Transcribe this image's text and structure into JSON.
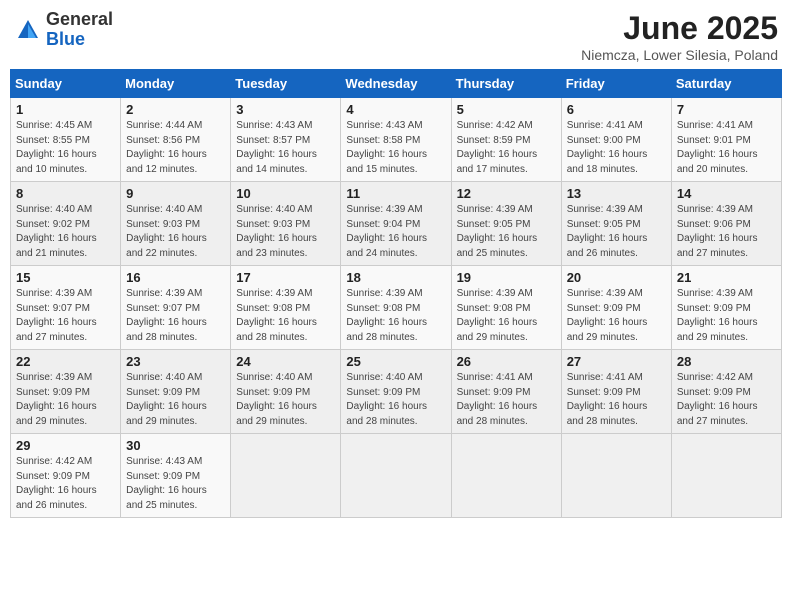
{
  "logo": {
    "general": "General",
    "blue": "Blue"
  },
  "title": "June 2025",
  "location": "Niemcza, Lower Silesia, Poland",
  "weekdays": [
    "Sunday",
    "Monday",
    "Tuesday",
    "Wednesday",
    "Thursday",
    "Friday",
    "Saturday"
  ],
  "days": [
    {
      "date": 1,
      "sunrise": "4:45 AM",
      "sunset": "8:55 PM",
      "daylight": "16 hours and 10 minutes."
    },
    {
      "date": 2,
      "sunrise": "4:44 AM",
      "sunset": "8:56 PM",
      "daylight": "16 hours and 12 minutes."
    },
    {
      "date": 3,
      "sunrise": "4:43 AM",
      "sunset": "8:57 PM",
      "daylight": "16 hours and 14 minutes."
    },
    {
      "date": 4,
      "sunrise": "4:43 AM",
      "sunset": "8:58 PM",
      "daylight": "16 hours and 15 minutes."
    },
    {
      "date": 5,
      "sunrise": "4:42 AM",
      "sunset": "8:59 PM",
      "daylight": "16 hours and 17 minutes."
    },
    {
      "date": 6,
      "sunrise": "4:41 AM",
      "sunset": "9:00 PM",
      "daylight": "16 hours and 18 minutes."
    },
    {
      "date": 7,
      "sunrise": "4:41 AM",
      "sunset": "9:01 PM",
      "daylight": "16 hours and 20 minutes."
    },
    {
      "date": 8,
      "sunrise": "4:40 AM",
      "sunset": "9:02 PM",
      "daylight": "16 hours and 21 minutes."
    },
    {
      "date": 9,
      "sunrise": "4:40 AM",
      "sunset": "9:03 PM",
      "daylight": "16 hours and 22 minutes."
    },
    {
      "date": 10,
      "sunrise": "4:40 AM",
      "sunset": "9:03 PM",
      "daylight": "16 hours and 23 minutes."
    },
    {
      "date": 11,
      "sunrise": "4:39 AM",
      "sunset": "9:04 PM",
      "daylight": "16 hours and 24 minutes."
    },
    {
      "date": 12,
      "sunrise": "4:39 AM",
      "sunset": "9:05 PM",
      "daylight": "16 hours and 25 minutes."
    },
    {
      "date": 13,
      "sunrise": "4:39 AM",
      "sunset": "9:05 PM",
      "daylight": "16 hours and 26 minutes."
    },
    {
      "date": 14,
      "sunrise": "4:39 AM",
      "sunset": "9:06 PM",
      "daylight": "16 hours and 27 minutes."
    },
    {
      "date": 15,
      "sunrise": "4:39 AM",
      "sunset": "9:07 PM",
      "daylight": "16 hours and 27 minutes."
    },
    {
      "date": 16,
      "sunrise": "4:39 AM",
      "sunset": "9:07 PM",
      "daylight": "16 hours and 28 minutes."
    },
    {
      "date": 17,
      "sunrise": "4:39 AM",
      "sunset": "9:08 PM",
      "daylight": "16 hours and 28 minutes."
    },
    {
      "date": 18,
      "sunrise": "4:39 AM",
      "sunset": "9:08 PM",
      "daylight": "16 hours and 28 minutes."
    },
    {
      "date": 19,
      "sunrise": "4:39 AM",
      "sunset": "9:08 PM",
      "daylight": "16 hours and 29 minutes."
    },
    {
      "date": 20,
      "sunrise": "4:39 AM",
      "sunset": "9:09 PM",
      "daylight": "16 hours and 29 minutes."
    },
    {
      "date": 21,
      "sunrise": "4:39 AM",
      "sunset": "9:09 PM",
      "daylight": "16 hours and 29 minutes."
    },
    {
      "date": 22,
      "sunrise": "4:39 AM",
      "sunset": "9:09 PM",
      "daylight": "16 hours and 29 minutes."
    },
    {
      "date": 23,
      "sunrise": "4:40 AM",
      "sunset": "9:09 PM",
      "daylight": "16 hours and 29 minutes."
    },
    {
      "date": 24,
      "sunrise": "4:40 AM",
      "sunset": "9:09 PM",
      "daylight": "16 hours and 29 minutes."
    },
    {
      "date": 25,
      "sunrise": "4:40 AM",
      "sunset": "9:09 PM",
      "daylight": "16 hours and 28 minutes."
    },
    {
      "date": 26,
      "sunrise": "4:41 AM",
      "sunset": "9:09 PM",
      "daylight": "16 hours and 28 minutes."
    },
    {
      "date": 27,
      "sunrise": "4:41 AM",
      "sunset": "9:09 PM",
      "daylight": "16 hours and 28 minutes."
    },
    {
      "date": 28,
      "sunrise": "4:42 AM",
      "sunset": "9:09 PM",
      "daylight": "16 hours and 27 minutes."
    },
    {
      "date": 29,
      "sunrise": "4:42 AM",
      "sunset": "9:09 PM",
      "daylight": "16 hours and 26 minutes."
    },
    {
      "date": 30,
      "sunrise": "4:43 AM",
      "sunset": "9:09 PM",
      "daylight": "16 hours and 25 minutes."
    }
  ]
}
